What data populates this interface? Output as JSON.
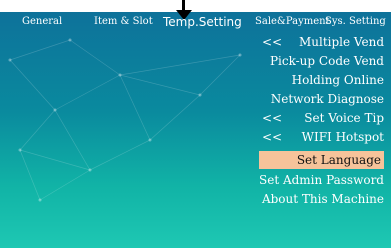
{
  "tabs": [
    {
      "label": "General"
    },
    {
      "label": "Item & Slot"
    },
    {
      "label": "Temp.Setting"
    },
    {
      "label": "Sale&Payment"
    },
    {
      "label": "Sys. Setting"
    }
  ],
  "active_tab": "Temp.Setting",
  "menu": {
    "items": [
      {
        "prefix": "<<",
        "label": "Multiple Vend"
      },
      {
        "prefix": "",
        "label": "Pick-up Code Vend"
      },
      {
        "prefix": "",
        "label": "Holding Online"
      },
      {
        "prefix": "",
        "label": "Network Diagnose"
      },
      {
        "prefix": "<<",
        "label": "Set Voice Tip"
      },
      {
        "prefix": "<<",
        "label": "WIFI Hotspot"
      },
      {
        "prefix": "",
        "label": "Set Language"
      },
      {
        "prefix": "",
        "label": "Set Admin Password"
      },
      {
        "prefix": "",
        "label": "About This Machine"
      }
    ],
    "selected": "Set Language"
  },
  "colors": {
    "background_top": "#0e6f9a",
    "background_bottom": "#1ec8b3",
    "selection": "#f6c39a",
    "text": "#ffffff"
  },
  "icons": {
    "pointer": "down-arrow-icon"
  }
}
